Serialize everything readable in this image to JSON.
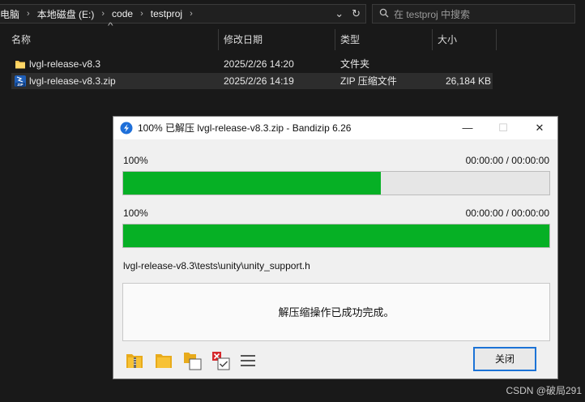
{
  "address": {
    "crumbs": [
      "电脑",
      "本地磁盘 (E:)",
      "code",
      "testproj"
    ],
    "separator": "›",
    "dropdown_glyph": "⌄",
    "refresh_glyph": "↻"
  },
  "search": {
    "placeholder": "在 testproj 中搜索",
    "icon": "search-icon"
  },
  "columns": {
    "name": "名称",
    "modified": "修改日期",
    "type": "类型",
    "size": "大小"
  },
  "files": [
    {
      "name": "lvgl-release-v8.3",
      "modified": "2025/2/26 14:20",
      "type": "文件夹",
      "size": "",
      "icon": "folder-icon"
    },
    {
      "name": "lvgl-release-v8.3.zip",
      "modified": "2025/2/26 14:19",
      "type": "ZIP 压缩文件",
      "size": "26,184 KB",
      "icon": "zip-archive-icon"
    }
  ],
  "dialog": {
    "title": "100% 已解压 lvgl-release-v8.3.zip - Bandizip 6.26",
    "minimize_glyph": "—",
    "maximize_glyph": "☐",
    "close_glyph": "✕",
    "progress1": {
      "label": "100%",
      "time": "00:00:00 / 00:00:00",
      "fill_fraction": 0.605
    },
    "progress2": {
      "label": "100%",
      "time": "00:00:00 / 00:00:00",
      "fill_fraction": 1.0
    },
    "current_file": "lvgl-release-v8.3\\tests\\unity\\unity_support.h",
    "message": "解压缩操作已成功完成。",
    "close_button": "关闭",
    "tool_icons": [
      "open-archive-icon",
      "open-folder-icon",
      "copy-icon",
      "delete-check-icon",
      "menu-icon"
    ]
  },
  "watermark": "CSDN @破局291",
  "colors": {
    "progress_green": "#06b025",
    "focus_blue": "#1c73d6",
    "explorer_bg": "#191919"
  }
}
